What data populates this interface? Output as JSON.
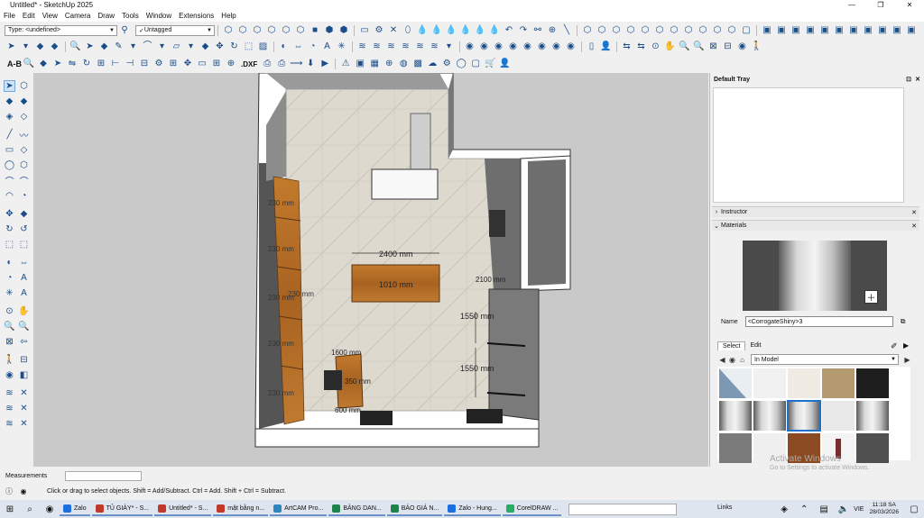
{
  "window": {
    "title": "Untitled* - SketchUp 2025",
    "minimize": "—",
    "maximize": "❐",
    "close": "✕"
  },
  "menu": [
    "File",
    "Edit",
    "View",
    "Camera",
    "Draw",
    "Tools",
    "Window",
    "Extensions",
    "Help"
  ],
  "toolbar": {
    "type_combo": "Type: <undefined>",
    "tag_combo": "Untagged",
    "row3_label": "A-B",
    "dxf_label": ".DXF"
  },
  "model": {
    "dims": [
      {
        "text": "2400 mm"
      },
      {
        "text": "1010 mm"
      },
      {
        "text": "230 mm"
      },
      {
        "text": "230 mm"
      },
      {
        "text": "230 mm"
      },
      {
        "text": "230 mm"
      },
      {
        "text": "230 mm"
      },
      {
        "text": "230 mm"
      },
      {
        "text": "1550 mm"
      },
      {
        "text": "1550 mm"
      },
      {
        "text": "1600 mm"
      },
      {
        "text": "2100 mm"
      },
      {
        "text": "600 mm"
      },
      {
        "text": "350 mm"
      }
    ]
  },
  "tray": {
    "title": "Default Tray",
    "instructor": "Instructor",
    "materials": "Materials",
    "name_label": "Name",
    "material_name": "<CorrogateShiny>3",
    "tab_select": "Select",
    "tab_edit": "Edit",
    "library": "In Model"
  },
  "measurements": {
    "label": "Measurements",
    "value": ""
  },
  "status": {
    "message": "Click or drag to select objects. Shift = Add/Subtract. Ctrl = Add. Shift + Ctrl = Subtract."
  },
  "taskbar": {
    "apps": [
      {
        "label": "Zalo",
        "color": "#1d6fe0"
      },
      {
        "label": "TỦ GIÀY* - S...",
        "color": "#c0392b"
      },
      {
        "label": "Untitled* - S...",
        "color": "#c0392b"
      },
      {
        "label": "mặt bằng n...",
        "color": "#c0392b"
      },
      {
        "label": "ArtCAM Pro...",
        "color": "#2e86c1"
      },
      {
        "label": "BẢNG DAN...",
        "color": "#1e8449"
      },
      {
        "label": "BÁO GIÁ N...",
        "color": "#1e8449"
      },
      {
        "label": "Zalo - Hung...",
        "color": "#1d6fe0"
      },
      {
        "label": "CorelDRAW ...",
        "color": "#27ae60"
      }
    ],
    "links": "Links",
    "lang": "VIE",
    "time": "11:18 SA",
    "date": "28/03/2026"
  },
  "watermark": {
    "line1": "Activate Windows",
    "line2": "Go to Settings to activate Windows."
  }
}
